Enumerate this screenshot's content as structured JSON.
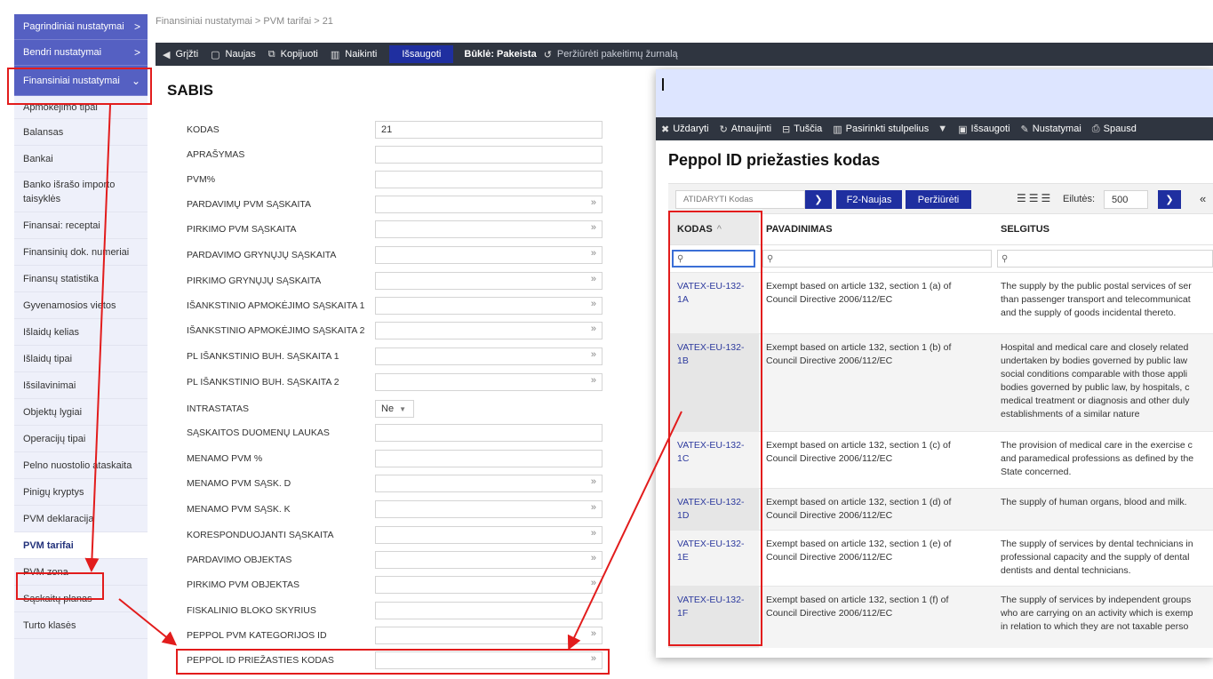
{
  "sidebar": {
    "top_items": [
      {
        "label": "Pagrindiniai nustatymai",
        "chevron": ">"
      },
      {
        "label": "Bendri nustatymai",
        "chevron": ">"
      },
      {
        "label": "Finansiniai nustatymai",
        "chevron": "⌄"
      }
    ],
    "items": [
      "Apmokėjimo tipai",
      "Balansas",
      "Bankai",
      "Banko išrašo importo taisyklės",
      "Finansai: receptai",
      "Finansinių dok. numeriai",
      "Finansų statistika",
      "Gyvenamosios vietos",
      "Išlaidų kelias",
      "Išlaidų tipai",
      "Išsilavinimai",
      "Objektų lygiai",
      "Operacijų tipai",
      "Pelno nuostolio ataskaita",
      "Pinigų kryptys",
      "PVM deklaracija",
      "PVM tarifai",
      "PVM zona",
      "Sąskaitų planas",
      "Turto klasės"
    ]
  },
  "breadcrumb": "Finansiniai nustatymai > PVM tarifai > 21",
  "toolbar": {
    "back": "Grįžti",
    "new": "Naujas",
    "copy": "Kopijuoti",
    "delete": "Naikinti",
    "save": "Išsaugoti",
    "status": "Būklė: Pakeista",
    "journal": "Peržiūrėti pakeitimų žurnalą"
  },
  "page_title": "SABIS",
  "form": [
    {
      "label": "KODAS",
      "value": "21"
    },
    {
      "label": "APRAŠYMAS",
      "value": ""
    },
    {
      "label": "PVM%",
      "value": ""
    },
    {
      "label": "PARDAVIMŲ PVM SĄSKAITA",
      "value": "",
      "picker": "»"
    },
    {
      "label": "PIRKIMO PVM SĄSKAITA",
      "value": "",
      "picker": "»"
    },
    {
      "label": "PARDAVIMO GRYNŲJŲ SĄSKAITA",
      "value": "",
      "picker": "»"
    },
    {
      "label": "PIRKIMO GRYNŲJŲ SĄSKAITA",
      "value": "",
      "picker": "»"
    },
    {
      "label": "IŠANKSTINIO APMOKĖJIMO SĄSKAITA 1",
      "value": "",
      "picker": "»"
    },
    {
      "label": "IŠANKSTINIO APMOKĖJIMO SĄSKAITA 2",
      "value": "",
      "picker": "»"
    },
    {
      "label": "PL IŠANKSTINIO BUH. SĄSKAITA 1",
      "value": "",
      "picker": "»"
    },
    {
      "label": "PL IŠANKSTINIO BUH. SĄSKAITA 2",
      "value": "",
      "picker": "»"
    },
    {
      "label": "INTRASTATAS",
      "select": "Ne"
    },
    {
      "label": "SĄSKAITOS DUOMENŲ LAUKAS",
      "value": ""
    },
    {
      "label": "MENAMO PVM %",
      "value": ""
    },
    {
      "label": "MENAMO PVM SĄSK. D",
      "value": "",
      "picker": "»"
    },
    {
      "label": "MENAMO PVM SĄSK. K",
      "value": "",
      "picker": "»"
    },
    {
      "label": "KORESPONDUOJANTI SĄSKAITA",
      "value": "",
      "picker": "»"
    },
    {
      "label": "PARDAVIMO OBJEKTAS",
      "value": "",
      "picker": "»"
    },
    {
      "label": "PIRKIMO PVM OBJEKTAS",
      "value": "",
      "picker": "»"
    },
    {
      "label": "FISKALINIO BLOKO SKYRIUS",
      "value": ""
    },
    {
      "label": "PEPPOL PVM KATEGORIJOS ID",
      "value": "",
      "picker": "»"
    },
    {
      "label": "PEPPOL ID PRIEŽASTIES KODAS",
      "value": "",
      "picker": "»"
    }
  ],
  "popup": {
    "toolbar": {
      "close": "Uždaryti",
      "refresh": "Atnaujinti",
      "empty": "Tuščia",
      "columns": "Pasirinkti stulpelius",
      "save": "Išsaugoti",
      "settings": "Nustatymai",
      "print": "Spausd"
    },
    "title": "Peppol ID priežasties kodas",
    "search_placeholder": "ATIDARYTI Kodas",
    "new_button": "F2-Naujas",
    "view_button": "Peržiūrėti",
    "rows_label": "Eilutės:",
    "rows_value": "500",
    "columns": {
      "code": "KODAS",
      "name": "PAVADINIMAS",
      "selgitus": "SELGITUS"
    },
    "rows": [
      {
        "code": [
          "VATEX-EU-132-",
          "1A"
        ],
        "name": [
          "Exempt based on article 132, section 1 (a) of",
          "Council Directive 2006/112/EC"
        ],
        "desc": [
          "The supply by the public postal services of ser",
          "than passenger transport and telecommunicat",
          "and the supply of goods incidental thereto."
        ]
      },
      {
        "code": [
          "VATEX-EU-132-",
          "1B"
        ],
        "name": [
          "Exempt based on article 132, section 1 (b) of",
          "Council Directive 2006/112/EC"
        ],
        "desc": [
          "Hospital and medical care and closely related",
          "undertaken by bodies governed by public law",
          "social conditions comparable with those appli",
          "bodies governed by public law, by hospitals, c",
          "medical treatment or diagnosis and other duly",
          "establishments of a similar nature"
        ]
      },
      {
        "code": [
          "VATEX-EU-132-",
          "1C"
        ],
        "name": [
          "Exempt based on article 132, section 1 (c) of",
          "Council Directive 2006/112/EC"
        ],
        "desc": [
          "The provision of medical care in the exercise c",
          "and paramedical professions as defined by the",
          "State concerned."
        ]
      },
      {
        "code": [
          "VATEX-EU-132-",
          "1D"
        ],
        "name": [
          "Exempt based on article 132, section 1 (d) of",
          "Council Directive 2006/112/EC"
        ],
        "desc": [
          "The supply of human organs, blood and milk."
        ]
      },
      {
        "code": [
          "VATEX-EU-132-",
          "1E"
        ],
        "name": [
          "Exempt based on article 132, section 1 (e) of",
          "Council Directive 2006/112/EC"
        ],
        "desc": [
          "The supply of services by dental technicians in",
          "professional capacity and the supply of dental",
          "dentists and dental technicians."
        ]
      },
      {
        "code": [
          "VATEX-EU-132-",
          "1F"
        ],
        "name": [
          "Exempt based on article 132, section 1 (f) of",
          "Council Directive 2006/112/EC"
        ],
        "desc": [
          "The supply of services by independent groups",
          "who are carrying on an activity which is exemp",
          "in relation to which they are not taxable perso"
        ]
      }
    ]
  },
  "colors": {
    "accent": "#5560c2",
    "toolbar": "#2f3540",
    "save": "#1f2fa0",
    "annotation": "#e21c1c"
  }
}
